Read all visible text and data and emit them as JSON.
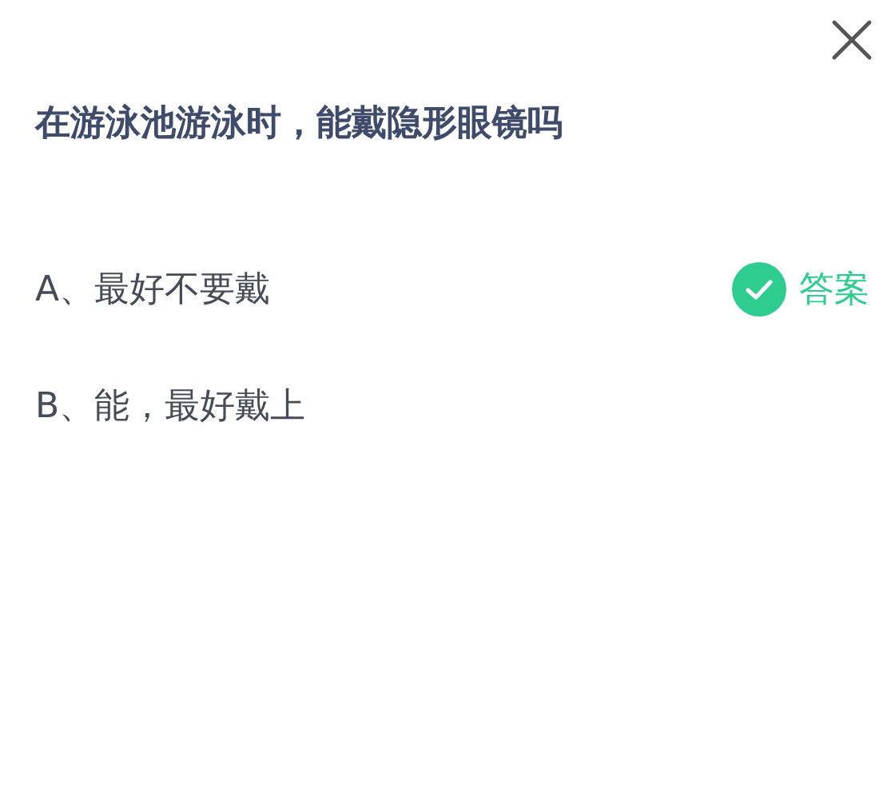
{
  "question": "在游泳池游泳时，能戴隐形眼镜吗",
  "options": [
    {
      "text": "A、最好不要戴",
      "correct": true,
      "badge": "答案"
    },
    {
      "text": "B、能，最好戴上",
      "correct": false
    }
  ]
}
